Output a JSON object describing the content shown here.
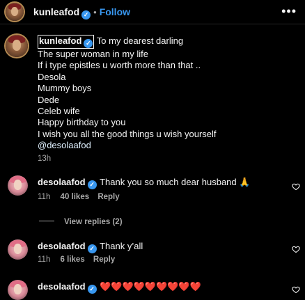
{
  "header": {
    "username": "kunleafod",
    "separator": "•",
    "follow_label": "Follow",
    "more_icon": "more-horizontal-icon"
  },
  "caption": {
    "username": "kunleafod",
    "lines": [
      "To my dearest darling",
      "The super woman in my life",
      "If i type epistles u worth more than that ..",
      "Desola",
      "Mummy boys",
      "Dede",
      "Celeb wife",
      "Happy birthday to you",
      "I wish you all the good things u wish yourself",
      "@desolaafod"
    ],
    "time": "13h"
  },
  "comments": [
    {
      "username": "desolaafod",
      "text": "Thank you so much dear husband 🙏",
      "time": "11h",
      "likes": "40 likes",
      "reply_label": "Reply"
    },
    {
      "username": "desolaafod",
      "text": "Thank y’all",
      "time": "11h",
      "likes": "6 likes",
      "reply_label": "Reply"
    },
    {
      "username": "desolaafod",
      "text": "❤️❤️❤️❤️❤️❤️❤️❤️❤️"
    }
  ],
  "view_replies": "View replies (2)",
  "colors": {
    "background": "#000000",
    "accent": "#3897f0",
    "secondary_text": "#a8a8a8"
  }
}
